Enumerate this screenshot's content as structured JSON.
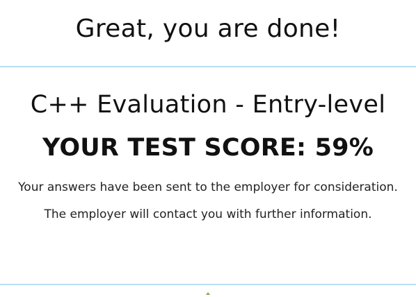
{
  "header": {
    "title": "Great, you are done!"
  },
  "result": {
    "test_name": "C++ Evaluation - Entry-level",
    "score_label": "YOUR TEST SCORE:",
    "score_value": "59%",
    "message_line1": "Your answers have been sent to the employer for consideration.",
    "message_line2": "The employer will contact you with further information."
  },
  "icons": {
    "scroll_top": "chevron-up-icon"
  },
  "colors": {
    "divider": "#b9dff0",
    "accent": "#7fb04a"
  }
}
